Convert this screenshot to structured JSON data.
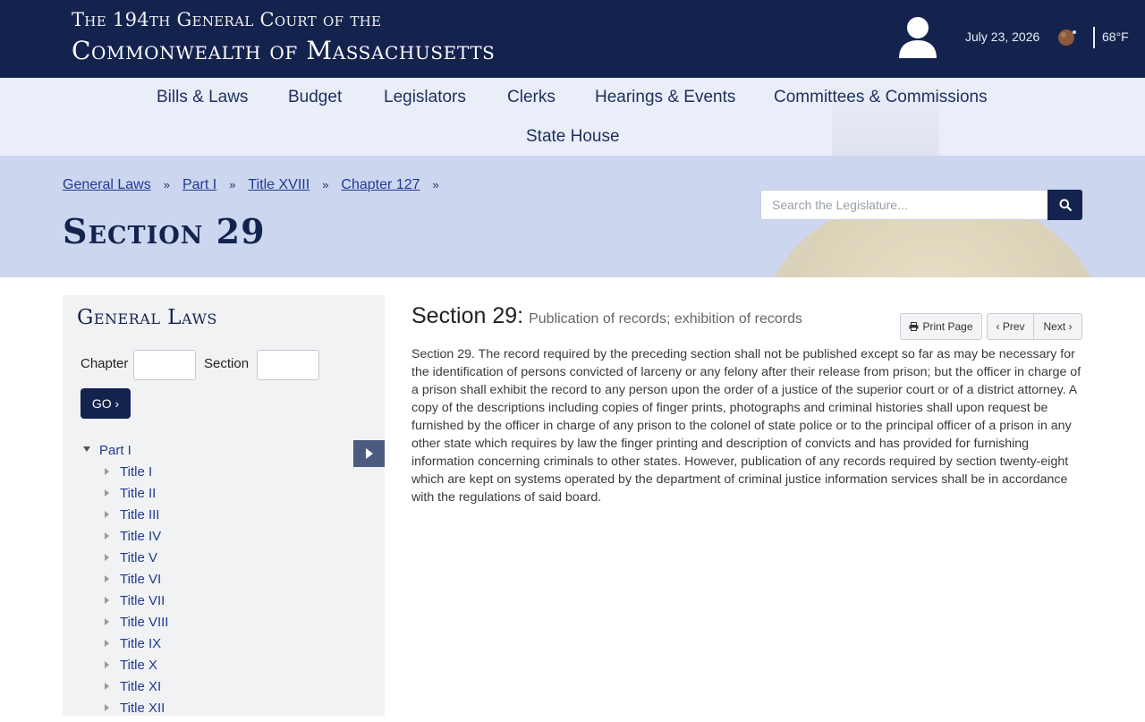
{
  "header": {
    "line1": "The 194th General Court of the",
    "line2": "Commonwealth of Massachusetts",
    "date": "July 23, 2026",
    "temperature": "68°F",
    "user_icon": "user-icon",
    "weather_icon": "moon-cloud-icon"
  },
  "nav": {
    "items": [
      "Bills & Laws",
      "Budget",
      "Legislators",
      "Clerks",
      "Hearings & Events",
      "Committees & Commissions",
      "State House"
    ]
  },
  "breadcrumb": {
    "items": [
      "General Laws",
      "Part I",
      "Title XVIII",
      "Chapter 127"
    ],
    "separator": "»"
  },
  "page": {
    "title": "Section 29"
  },
  "search": {
    "placeholder": "Search the Legislature...",
    "icon": "search-icon"
  },
  "sidebar": {
    "title": "General Laws",
    "chapter_label": "Chapter",
    "section_label": "Section",
    "go_label": "GO ›",
    "tree_root": "Part I",
    "titles": [
      "Title I",
      "Title II",
      "Title III",
      "Title IV",
      "Title V",
      "Title VI",
      "Title VII",
      "Title VIII",
      "Title IX",
      "Title X",
      "Title XI",
      "Title XII"
    ]
  },
  "content": {
    "heading": "Section 29:",
    "subheading": "Publication of records; exhibition of records",
    "print_label": "Print Page",
    "prev_label": "‹ Prev",
    "next_label": "Next ›",
    "text": "Section 29. The record required by the preceding section shall not be published except so far as may be necessary for the identification of persons convicted of larceny or any felony after their release from prison; but the officer in charge of a prison shall exhibit the record to any person upon the order of a justice of the superior court or of a district attorney. A copy of the descriptions including copies of finger prints, photographs and criminal histories shall upon request be furnished by the officer in charge of any prison to the colonel of state police or to the principal officer of a prison in any other state which requires by law the finger printing and description of convicts and has provided for furnishing information concerning criminals to other states. However, publication of any records required by section twenty-eight which are kept on systems operated by the department of criminal justice information services shall be in accordance with the regulations of said board."
  }
}
